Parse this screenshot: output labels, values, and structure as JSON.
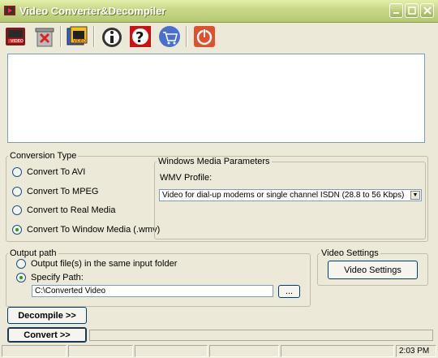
{
  "window": {
    "title": "Video Converter&Decompiler"
  },
  "toolbar": {
    "buttons": [
      {
        "name": "open-video",
        "icon": "film-video-icon"
      },
      {
        "name": "delete",
        "icon": "trash-bin-icon"
      },
      {
        "name": "add-files",
        "icon": "film-stack-icon"
      },
      {
        "name": "info",
        "icon": "info-icon"
      },
      {
        "name": "help",
        "icon": "help-question-icon"
      },
      {
        "name": "buy",
        "icon": "shopping-cart-icon"
      },
      {
        "name": "exit",
        "icon": "power-icon"
      }
    ]
  },
  "conversion_type": {
    "legend": "Conversion Type",
    "options": [
      {
        "label": "Convert To AVI",
        "selected": false
      },
      {
        "label": "Convert To MPEG",
        "selected": false
      },
      {
        "label": "Convert to Real Media",
        "selected": false
      },
      {
        "label": "Convert To Window Media (.wmv)",
        "selected": true
      }
    ]
  },
  "wm_params": {
    "legend": "Windows Media Parameters",
    "profile_label": "WMV Profile:",
    "profile_value": "Video for dial-up modems or single channel ISDN (28.8 to 56 Kbps)"
  },
  "output_path": {
    "legend": "Output path",
    "options": [
      {
        "label": "Output file(s) in the same input folder",
        "selected": false
      },
      {
        "label": "Specify Path:",
        "selected": true
      }
    ],
    "path_value": "C:\\Converted Video",
    "browse_label": "..."
  },
  "video_settings": {
    "legend": "Video Settings",
    "button_label": "Video Settings"
  },
  "actions": {
    "decompile_label": "Decompile >>",
    "convert_label": "Convert >>"
  },
  "progress": {
    "value": 0
  },
  "statusbar": {
    "time": "2:03 PM"
  },
  "colors": {
    "titlebar": "#c9d98a",
    "window_bg": "#ece9d8",
    "border_blue": "#7f9db9",
    "button_border": "#003c74"
  }
}
